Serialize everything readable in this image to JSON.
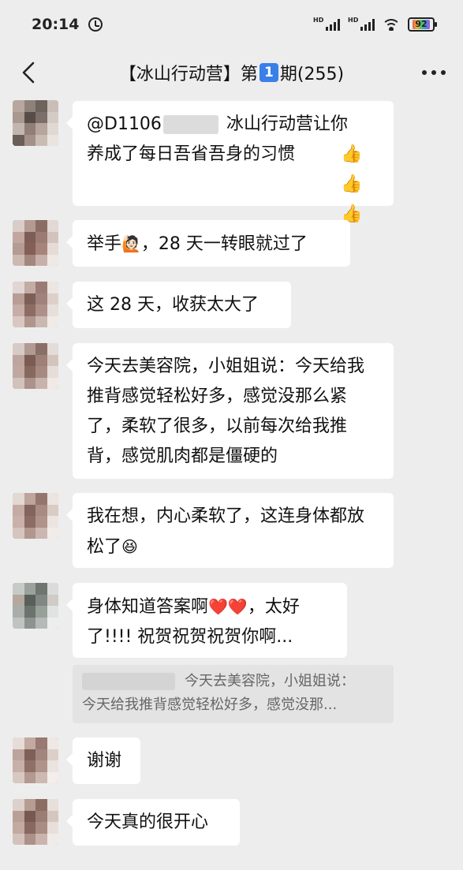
{
  "status_bar": {
    "time": "20:14",
    "alarm_icon": "alarm-clock-icon",
    "signal1": "HD",
    "signal2": "HD",
    "battery": "92"
  },
  "title_bar": {
    "title_prefix": "【冰山行动营】第",
    "title_badge": "1",
    "title_suffix": "期(255)",
    "back_icon": "chevron-left-icon",
    "more_icon": "more-dots-icon"
  },
  "messages": [
    {
      "line1_prefix": "@D1106",
      "line1_suffix": "冰山行动营让你",
      "line2": "养成了每日吾省吾身的习惯",
      "reactions": "👍👍👍"
    },
    {
      "before_emoji": "举手",
      "emoji": "🙋🏻",
      "after_emoji": "，28 天一转眼就过了"
    },
    {
      "text": "这 28 天，收获太大了"
    },
    {
      "text": "今天去美容院，小姐姐说：今天给我推背感觉轻松好多，感觉没那么紧了，柔软了很多，以前每次给我推背，感觉肌肉都是僵硬的"
    },
    {
      "text": "我在想，内心柔软了，这连身体都放松了",
      "emoji": "😆"
    },
    {
      "before_hearts": "身体知道答案啊",
      "hearts": "❤️❤️",
      "after_hearts": "，太好了!!!! 祝贺祝贺祝贺你啊..."
    },
    {
      "quote_line1": "今天去美容院，小姐姐说：",
      "quote_line2": "今天给我推背感觉轻松好多，感觉没那..."
    },
    {
      "text": "谢谢"
    },
    {
      "text": "今天真的很开心"
    }
  ]
}
